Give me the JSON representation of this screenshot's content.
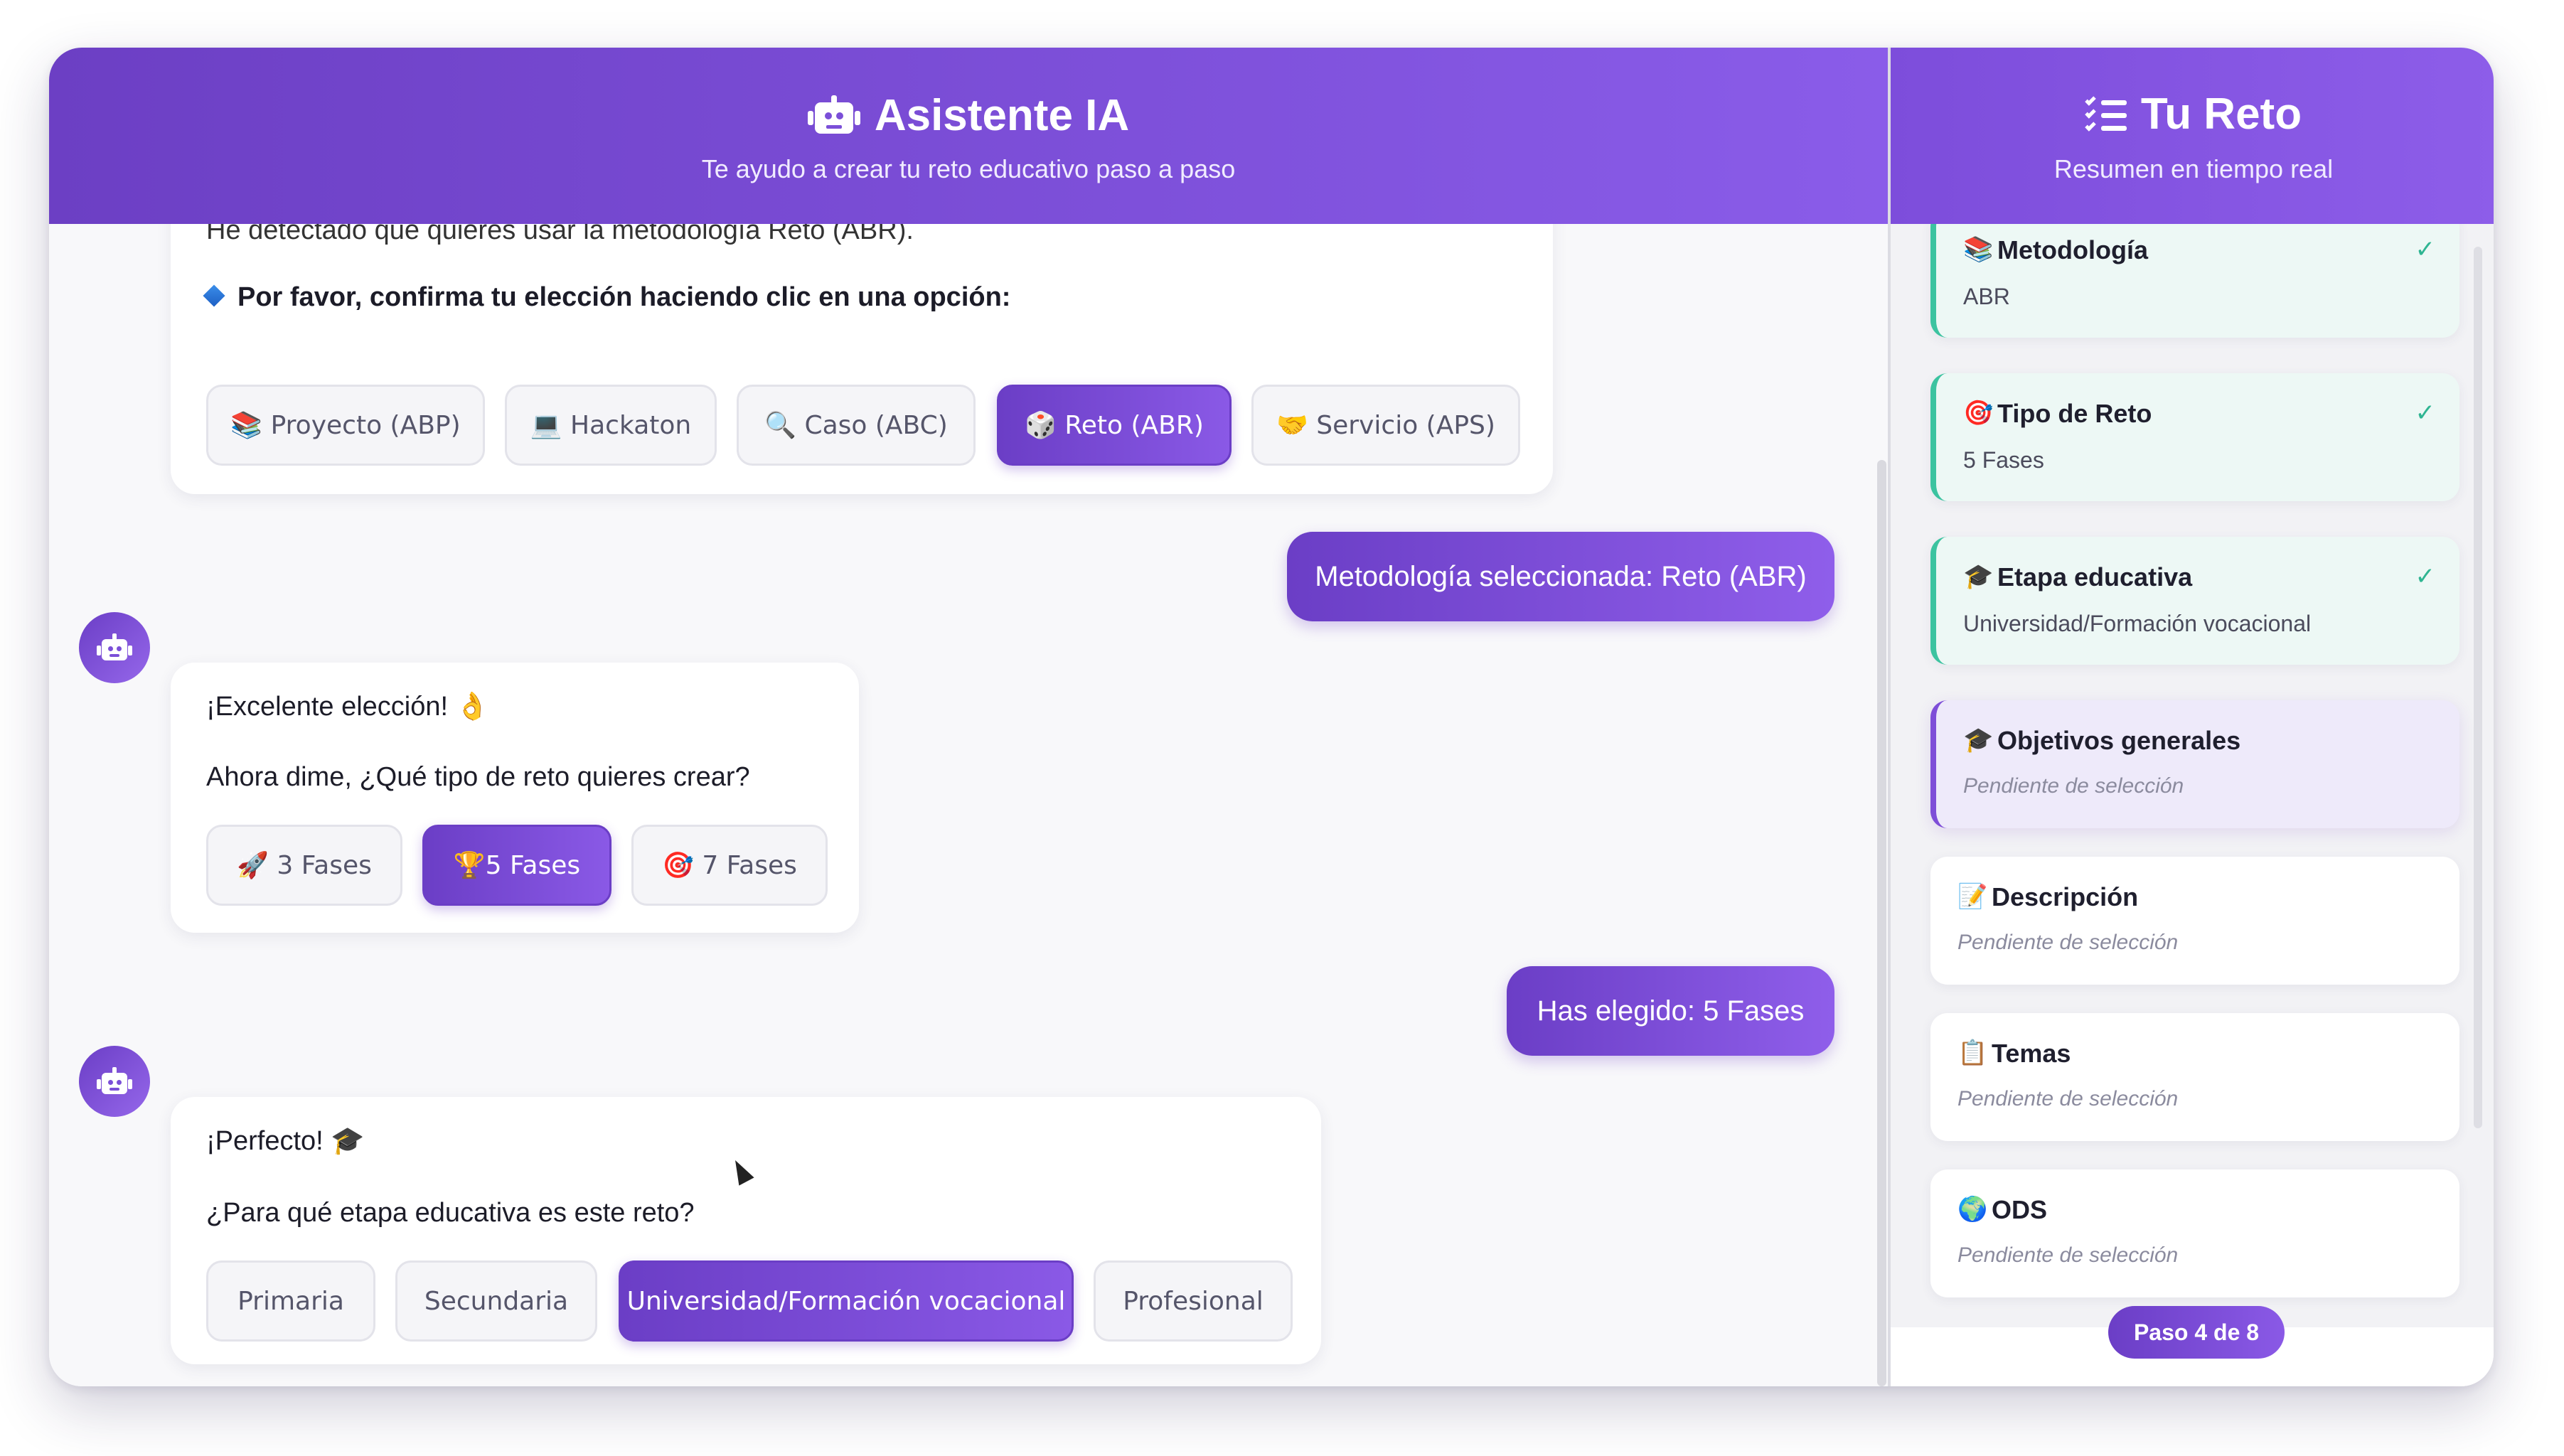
{
  "chat": {
    "title": "Asistente IA",
    "subtitle": "Te ayudo a crear tu reto educativo paso a paso",
    "partial_line": "He detectado que quieres usar la metodología Reto (ABR).",
    "confirm_prompt": "Por favor, confirma tu elección haciendo clic en una opción:",
    "methodology_options": [
      {
        "label": "📚 Proyecto (ABP)",
        "selected": false
      },
      {
        "label": "💻 Hackaton",
        "selected": false
      },
      {
        "label": "🔍 Caso (ABC)",
        "selected": false
      },
      {
        "label": "🎲 Reto (ABR)",
        "selected": true
      },
      {
        "label": "🤝 Servicio (APS)",
        "selected": false
      }
    ],
    "user_msg_1": "Metodología seleccionada: Reto (ABR)",
    "bot_msg_2_line1": "¡Excelente elección! 👌",
    "bot_msg_2_line2": "Ahora dime, ¿Qué tipo de reto quieres crear?",
    "type_options": [
      {
        "label": "🚀 3 Fases",
        "selected": false
      },
      {
        "label": "🏆5 Fases",
        "selected": true
      },
      {
        "label": "🎯 7 Fases",
        "selected": false
      }
    ],
    "user_msg_2": "Has elegido: 5 Fases",
    "bot_msg_3_line1": "¡Perfecto! 🎓",
    "bot_msg_3_line2": "¿Para qué etapa educativa es este reto?",
    "stage_options": [
      {
        "label": "Primaria",
        "selected": false
      },
      {
        "label": "Secundaria",
        "selected": false
      },
      {
        "label": "Universidad/Formación vocacional",
        "selected": true
      },
      {
        "label": "Profesional",
        "selected": false
      }
    ]
  },
  "summary": {
    "title": "Tu Reto",
    "subtitle": "Resumen en tiempo real",
    "cards": [
      {
        "icon": "📚",
        "title": "Metodología",
        "value": "ABR",
        "status": "done"
      },
      {
        "icon": "🎯",
        "title": "Tipo de Reto",
        "value": "5 Fases",
        "status": "done"
      },
      {
        "icon": "🎓",
        "title": "Etapa educativa",
        "value": "Universidad/Formación vocacional",
        "status": "done"
      },
      {
        "icon": "🎓",
        "title": "Objetivos generales",
        "value": "Pendiente de selección",
        "status": "current"
      },
      {
        "icon": "📝",
        "title": "Descripción",
        "value": "Pendiente de selección",
        "status": "pending"
      },
      {
        "icon": "📋",
        "title": "Temas",
        "value": "Pendiente de selección",
        "status": "pending"
      },
      {
        "icon": "🌍",
        "title": "ODS",
        "value": "Pendiente de selección",
        "status": "pending"
      }
    ],
    "check_mark": "✓",
    "step_label": "Paso 4 de 8"
  },
  "colors": {
    "accent": "#7b4fd8",
    "accent_dark": "#6b3ec6",
    "done_border": "#3cc3a0",
    "done_bg": "#edf8f5"
  }
}
